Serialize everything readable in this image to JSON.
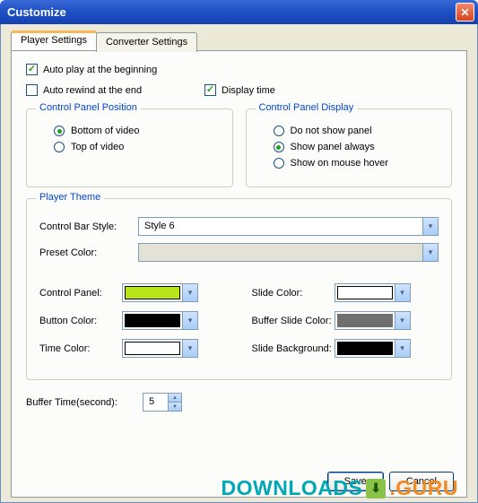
{
  "window": {
    "title": "Customize"
  },
  "tabs": {
    "player": "Player Settings",
    "converter": "Converter Settings"
  },
  "options": {
    "autoplay": "Auto play at the beginning",
    "autorewind": "Auto rewind at the end",
    "displaytime": "Display time"
  },
  "groups": {
    "position": {
      "title": "Control Panel Position",
      "bottom": "Bottom of video",
      "top": "Top of video"
    },
    "display": {
      "title": "Control Panel Display",
      "none": "Do not show panel",
      "always": "Show panel always",
      "hover": "Show on mouse hover"
    },
    "theme": {
      "title": "Player Theme",
      "barstyle_label": "Control Bar Style:",
      "barstyle_value": "Style 6",
      "preset_label": "Preset Color:",
      "preset_value": "",
      "controlpanel_label": "Control Panel:",
      "button_label": "Button Color:",
      "time_label": "Time Color:",
      "slide_label": "Slide Color:",
      "bufferslide_label": "Buffer Slide Color:",
      "slidebg_label": "Slide Background:"
    }
  },
  "colors": {
    "control_panel": "#b9e41d",
    "button": "#000000",
    "time": "#ffffff",
    "slide": "#ffffff",
    "buffer_slide": "#6f6f6f",
    "slide_bg": "#000000"
  },
  "buffer": {
    "label": "Buffer Time(second):",
    "value": "5"
  },
  "buttons": {
    "save": "Save",
    "cancel": "Cancel"
  },
  "watermark": {
    "text1": "DOWNLOADS",
    "text2": ".GURU"
  }
}
